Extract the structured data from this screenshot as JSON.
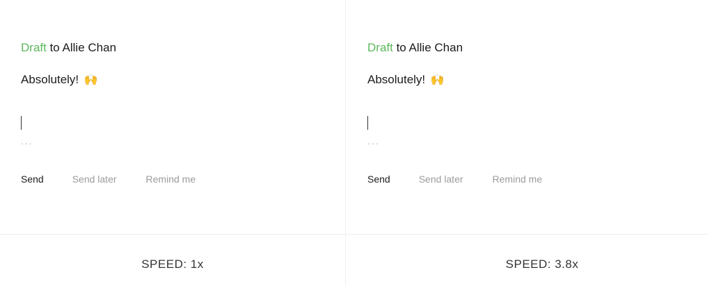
{
  "panes": [
    {
      "draft_label": "Draft",
      "recipient_text": " to Allie Chan",
      "message_text": "Absolutely!",
      "emoji_icon": "raising-hands-emoji",
      "emoji_glyph": "🙌",
      "ellipsis": "...",
      "actions": {
        "send": "Send",
        "send_later": "Send later",
        "remind_me": "Remind me"
      },
      "speed_label": "SPEED: 1x"
    },
    {
      "draft_label": "Draft",
      "recipient_text": " to Allie Chan",
      "message_text": "Absolutely!",
      "emoji_icon": "raising-hands-emoji",
      "emoji_glyph": "🙌",
      "ellipsis": "...",
      "actions": {
        "send": "Send",
        "send_later": "Send later",
        "remind_me": "Remind me"
      },
      "speed_label": "SPEED: 3.8x"
    }
  ],
  "colors": {
    "draft_green": "#5cb85c",
    "text_dark": "#1b1b1b",
    "text_muted": "#9b9b9b"
  }
}
